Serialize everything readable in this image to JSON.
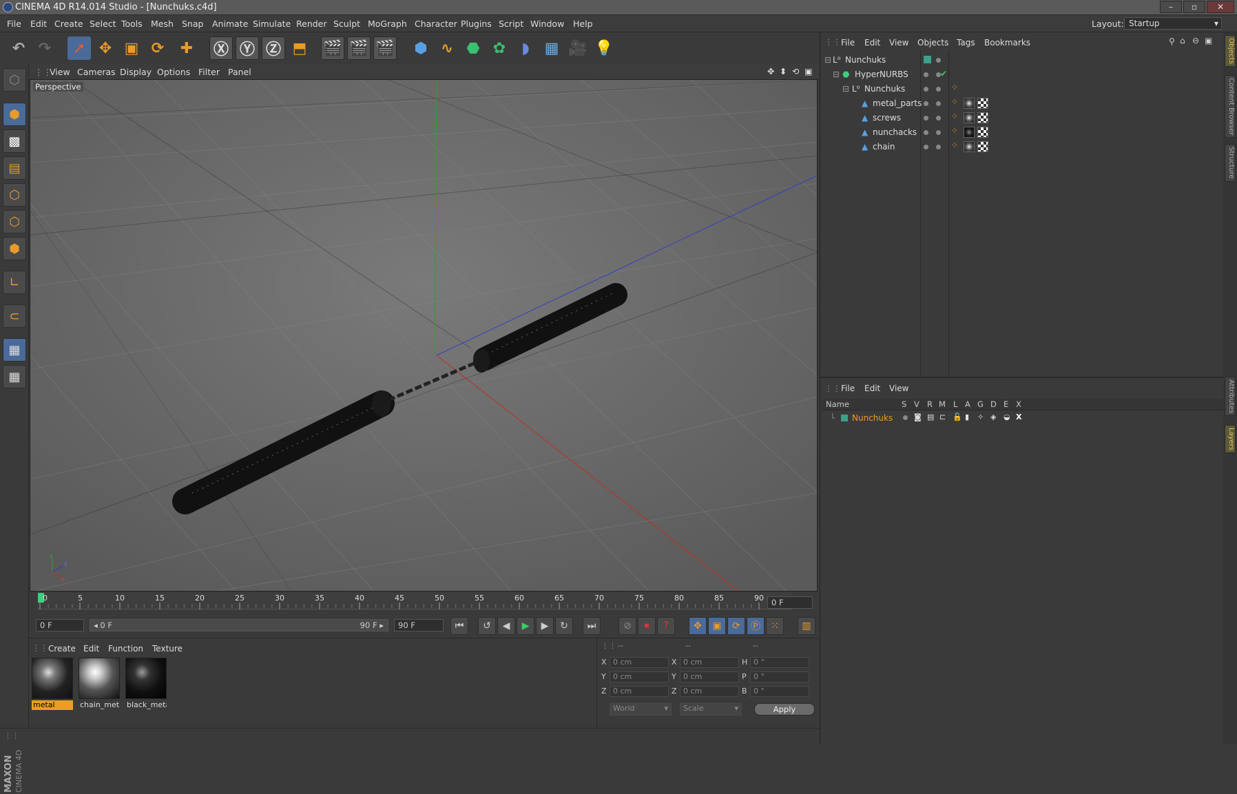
{
  "window": {
    "title": "CINEMA 4D R14.014 Studio - [Nunchuks.c4d]",
    "min": "–",
    "max": "▫",
    "close": "✕"
  },
  "menu": [
    "File",
    "Edit",
    "Create",
    "Select",
    "Tools",
    "Mesh",
    "Snap",
    "Animate",
    "Simulate",
    "Render",
    "Sculpt",
    "MoGraph",
    "Character",
    "Plugins",
    "Script",
    "Window",
    "Help"
  ],
  "layout": {
    "label": "Layout:",
    "value": "Startup"
  },
  "viewport": {
    "menu": [
      "View",
      "Cameras",
      "Display",
      "Options",
      "Filter",
      "Panel"
    ],
    "label": "Perspective",
    "axis_y": "y",
    "axis_z": "z",
    "axis_x": "x"
  },
  "timeline": {
    "ticks": [
      "0",
      "5",
      "10",
      "15",
      "20",
      "25",
      "30",
      "35",
      "40",
      "45",
      "50",
      "55",
      "60",
      "65",
      "70",
      "75",
      "80",
      "85",
      "90"
    ],
    "current": "0 F"
  },
  "transport": {
    "start": "0 F",
    "range_start": "◂ 0 F",
    "range_end": "90 F ▸",
    "end": "90 F"
  },
  "materials": {
    "menu": [
      "Create",
      "Edit",
      "Function",
      "Texture"
    ],
    "items": [
      {
        "name": "metal",
        "selected": true
      },
      {
        "name": "chain_meta",
        "selected": false
      },
      {
        "name": "black_meta",
        "selected": false
      }
    ]
  },
  "coords": {
    "headers": [
      "--",
      "--",
      "--"
    ],
    "rows": [
      {
        "a": "X",
        "av": "0 cm",
        "b": "X",
        "bv": "0 cm",
        "c": "H",
        "cv": "0 °"
      },
      {
        "a": "Y",
        "av": "0 cm",
        "b": "Y",
        "bv": "0 cm",
        "c": "P",
        "cv": "0 °"
      },
      {
        "a": "Z",
        "av": "0 cm",
        "b": "Z",
        "bv": "0 cm",
        "c": "B",
        "cv": "0 °"
      }
    ],
    "space": "World",
    "mode": "Scale",
    "apply": "Apply"
  },
  "objects": {
    "menu": [
      "File",
      "Edit",
      "View",
      "Objects",
      "Tags",
      "Bookmarks"
    ],
    "tree": [
      {
        "name": "Nunchuks",
        "indent": 0
      },
      {
        "name": "HyperNURBS",
        "indent": 1
      },
      {
        "name": "Nunchuks",
        "indent": 2
      },
      {
        "name": "metal_parts",
        "indent": 3
      },
      {
        "name": "screws",
        "indent": 3
      },
      {
        "name": "nunchacks",
        "indent": 3
      },
      {
        "name": "chain",
        "indent": 3
      }
    ]
  },
  "layers": {
    "menu": [
      "File",
      "Edit",
      "View"
    ],
    "columns": [
      "Name",
      "S",
      "V",
      "R",
      "M",
      "L",
      "A",
      "G",
      "D",
      "E",
      "X"
    ],
    "items": [
      {
        "name": "Nunchuks"
      }
    ]
  },
  "sidetabs": [
    "Objects",
    "Content Browser",
    "Structure",
    "Attributes",
    "Layers"
  ],
  "brand": {
    "maxon": "MAXON",
    "product": "CINEMA 4D"
  },
  "colors": {
    "accent": "#e89a2a",
    "selection": "#4a6a99",
    "axis_x": "#c03020",
    "axis_y": "#30a030",
    "axis_z": "#3040c0",
    "layer": "#e8a020"
  }
}
